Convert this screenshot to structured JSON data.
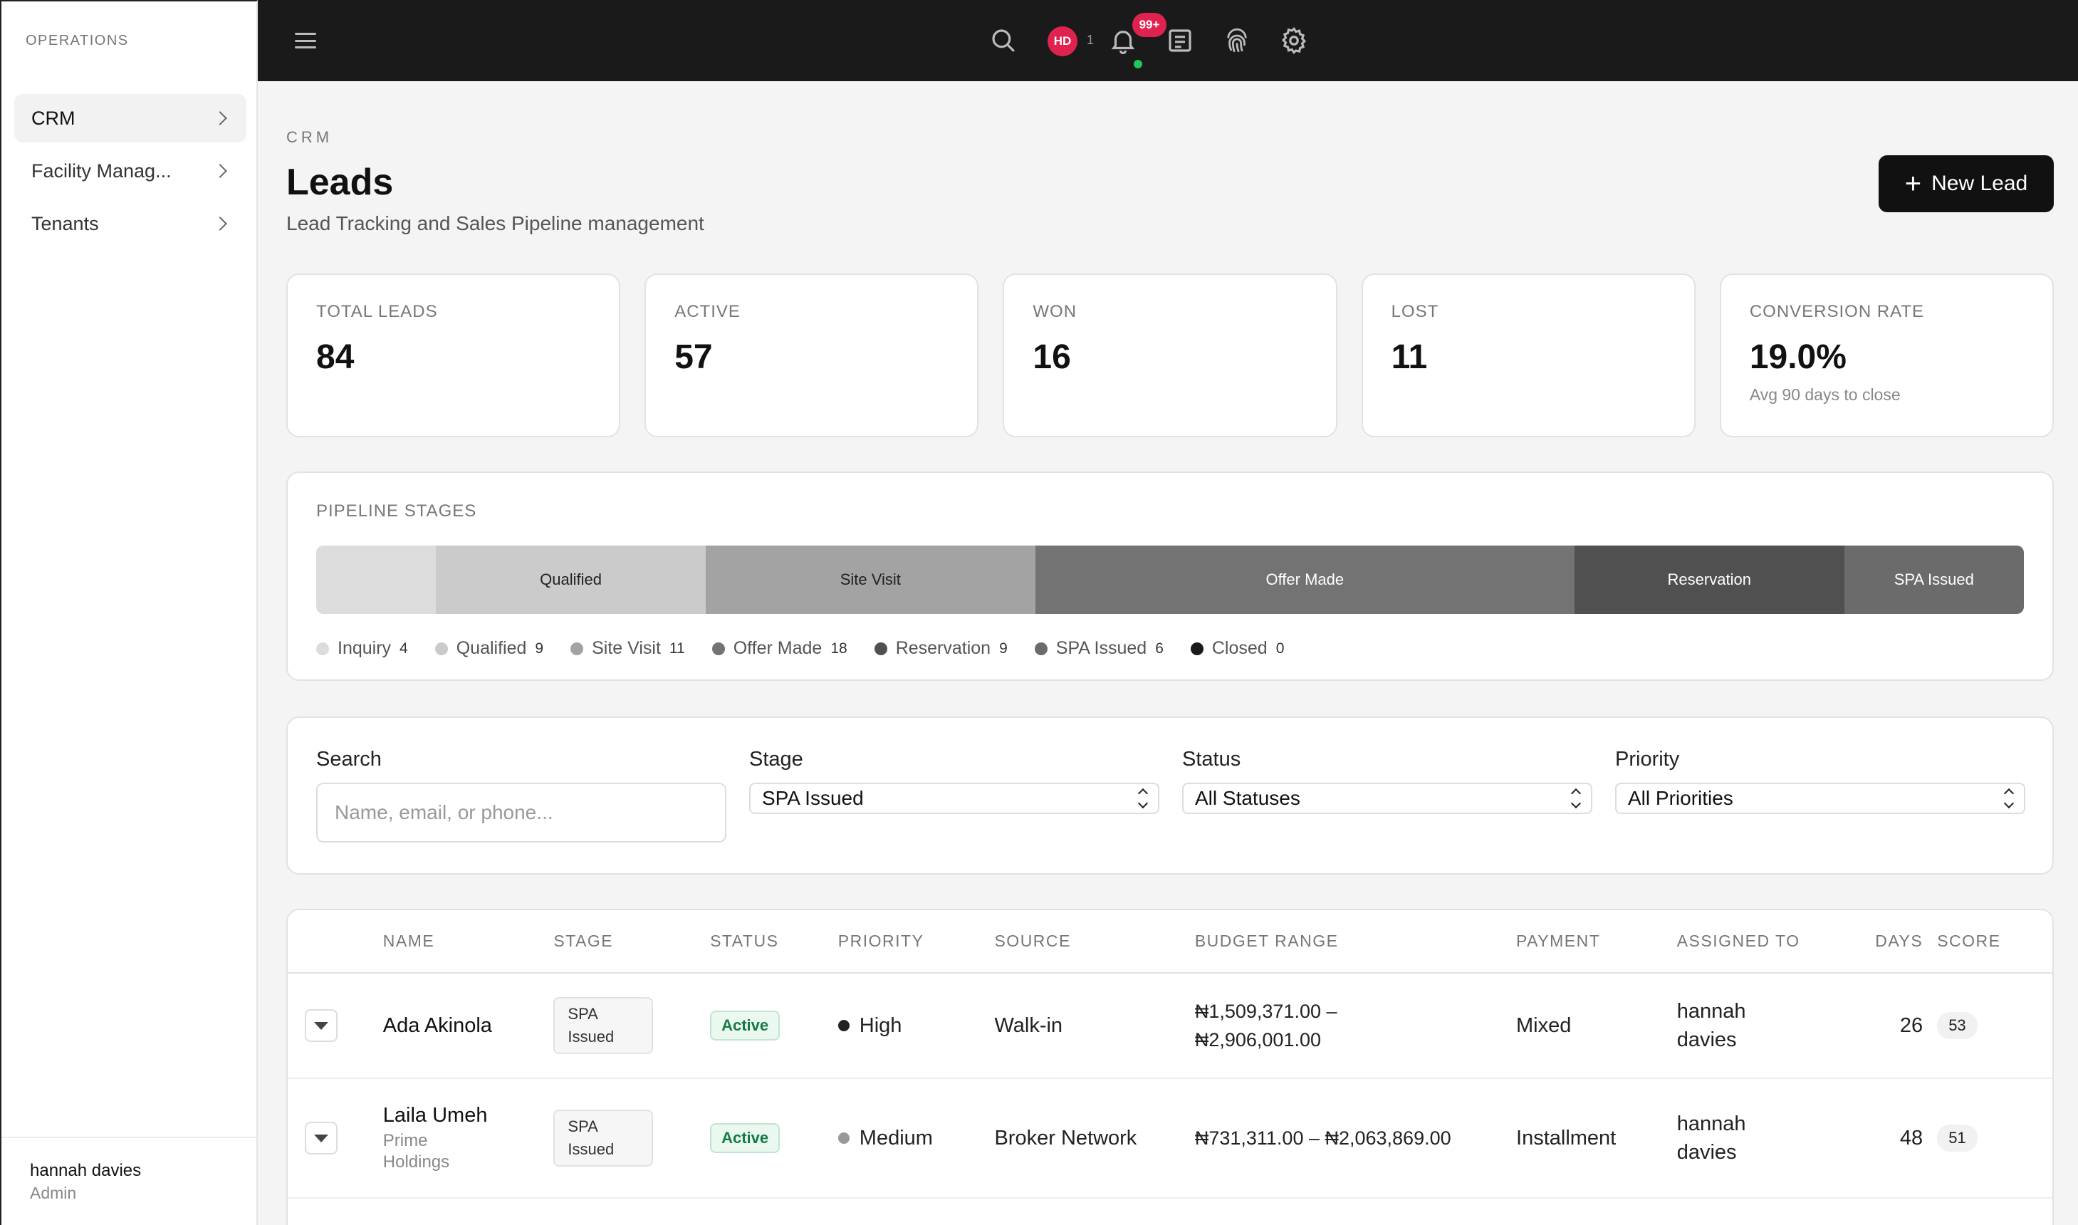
{
  "sidebar": {
    "heading": "OPERATIONS",
    "items": [
      {
        "label": "CRM"
      },
      {
        "label": "Facility Manag..."
      },
      {
        "label": "Tenants"
      }
    ],
    "user": {
      "name": "hannah davies",
      "role": "Admin"
    }
  },
  "topbar": {
    "avatar_initials": "HD",
    "avatar_count": "1",
    "notifications_badge": "99+"
  },
  "header": {
    "breadcrumb": "CRM",
    "title": "Leads",
    "subtitle": "Lead Tracking and Sales Pipeline management",
    "new_lead_label": "New Lead"
  },
  "stats": [
    {
      "label": "TOTAL LEADS",
      "value": "84"
    },
    {
      "label": "ACTIVE",
      "value": "57"
    },
    {
      "label": "WON",
      "value": "16"
    },
    {
      "label": "LOST",
      "value": "11"
    },
    {
      "label": "CONVERSION RATE",
      "value": "19.0%",
      "note": "Avg 90 days to close"
    }
  ],
  "pipeline": {
    "label": "PIPELINE STAGES",
    "stages": [
      {
        "name": "Inquiry",
        "count": 4,
        "bar_label": "",
        "color": "#dcdcdc",
        "text_color": "#333333"
      },
      {
        "name": "Qualified",
        "count": 9,
        "bar_label": "Qualified",
        "color": "#cbcbcb",
        "text_color": "#222222"
      },
      {
        "name": "Site Visit",
        "count": 11,
        "bar_label": "Site Visit",
        "color": "#a3a3a3",
        "text_color": "#222222"
      },
      {
        "name": "Offer Made",
        "count": 18,
        "bar_label": "Offer Made",
        "color": "#737373",
        "text_color": "#ffffff"
      },
      {
        "name": "Reservation",
        "count": 9,
        "bar_label": "Reservation",
        "color": "#505050",
        "text_color": "#ffffff"
      },
      {
        "name": "SPA Issued",
        "count": 6,
        "bar_label": "SPA Issued",
        "color": "#6b6b6b",
        "text_color": "#ffffff"
      },
      {
        "name": "Closed",
        "count": 0,
        "bar_label": "",
        "color": "#1a1a1a",
        "text_color": "#ffffff"
      }
    ]
  },
  "filters": {
    "search_label": "Search",
    "search_placeholder": "Name, email, or phone...",
    "stage_label": "Stage",
    "stage_value": "SPA Issued",
    "status_label": "Status",
    "status_value": "All Statuses",
    "priority_label": "Priority",
    "priority_value": "All Priorities"
  },
  "table": {
    "columns": [
      "NAME",
      "STAGE",
      "STATUS",
      "PRIORITY",
      "SOURCE",
      "BUDGET RANGE",
      "PAYMENT",
      "ASSIGNED TO",
      "DAYS",
      "SCORE"
    ],
    "rows": [
      {
        "name": "Ada Akinola",
        "company": "",
        "stage": "SPA Issued",
        "status": "Active",
        "priority": "High",
        "priority_color": "#222222",
        "source": "Walk-in",
        "budget": "₦1,509,371.00 – ₦2,906,001.00",
        "payment": "Mixed",
        "assigned": "hannah davies",
        "days": "26",
        "score": "53"
      },
      {
        "name": "Laila Umeh",
        "company": "Prime Holdings",
        "stage": "SPA Issued",
        "status": "Active",
        "priority": "Medium",
        "priority_color": "#999999",
        "source": "Broker Network",
        "budget": "₦731,311.00 – ₦2,063,869.00",
        "payment": "Installment",
        "assigned": "hannah davies",
        "days": "48",
        "score": "51"
      }
    ]
  }
}
